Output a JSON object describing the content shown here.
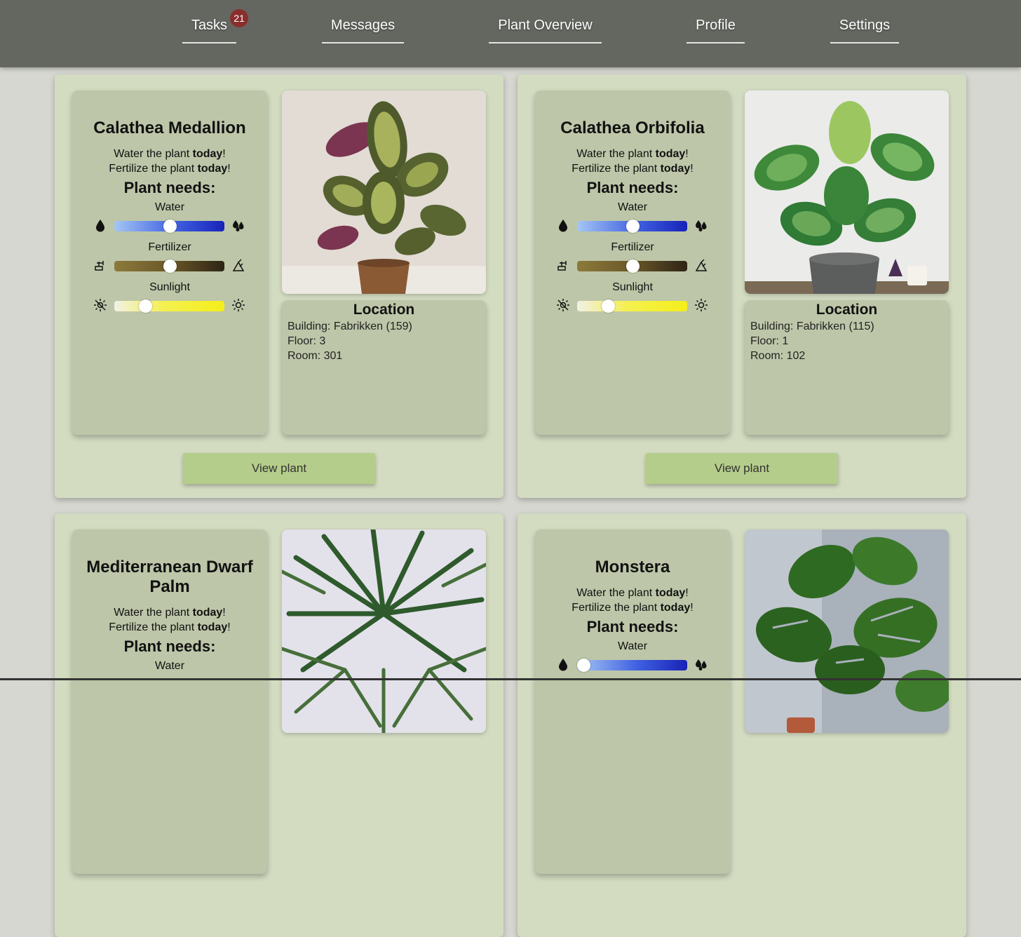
{
  "nav": {
    "items": [
      {
        "label": "Tasks",
        "badge": "21"
      },
      {
        "label": "Messages"
      },
      {
        "label": "Plant Overview"
      },
      {
        "label": "Profile"
      },
      {
        "label": "Settings"
      }
    ]
  },
  "common": {
    "task_water_prefix": "Water the plant ",
    "task_fert_prefix": "Fertilize the plant ",
    "task_suffix_bold": "today",
    "task_suffix_end": "!",
    "needs_heading": "Plant needs:",
    "water_label": "Water",
    "fertilizer_label": "Fertilizer",
    "sunlight_label": "Sunlight",
    "location_heading": "Location",
    "view_button": "View plant"
  },
  "plants": [
    {
      "name": "Calathea Medallion",
      "water_level": 0.5,
      "fertilizer_level": 0.5,
      "sunlight_level": 0.28,
      "location": {
        "building": "Building: Fabrikken (159)",
        "floor": "Floor: 3",
        "room": "Room: 301"
      }
    },
    {
      "name": "Calathea Orbifolia",
      "water_level": 0.5,
      "fertilizer_level": 0.5,
      "sunlight_level": 0.28,
      "location": {
        "building": "Building: Fabrikken (115)",
        "floor": "Floor: 1",
        "room": "Room: 102"
      }
    },
    {
      "name": "Mediterranean Dwarf Palm"
    },
    {
      "name": "Monstera",
      "water_level": 0.06
    }
  ],
  "colors": {
    "topbar": "#646760",
    "card": "#d3dbc1",
    "panel": "#bdc6a8",
    "button": "#b5cd8a",
    "badge": "#8a2e2e"
  }
}
